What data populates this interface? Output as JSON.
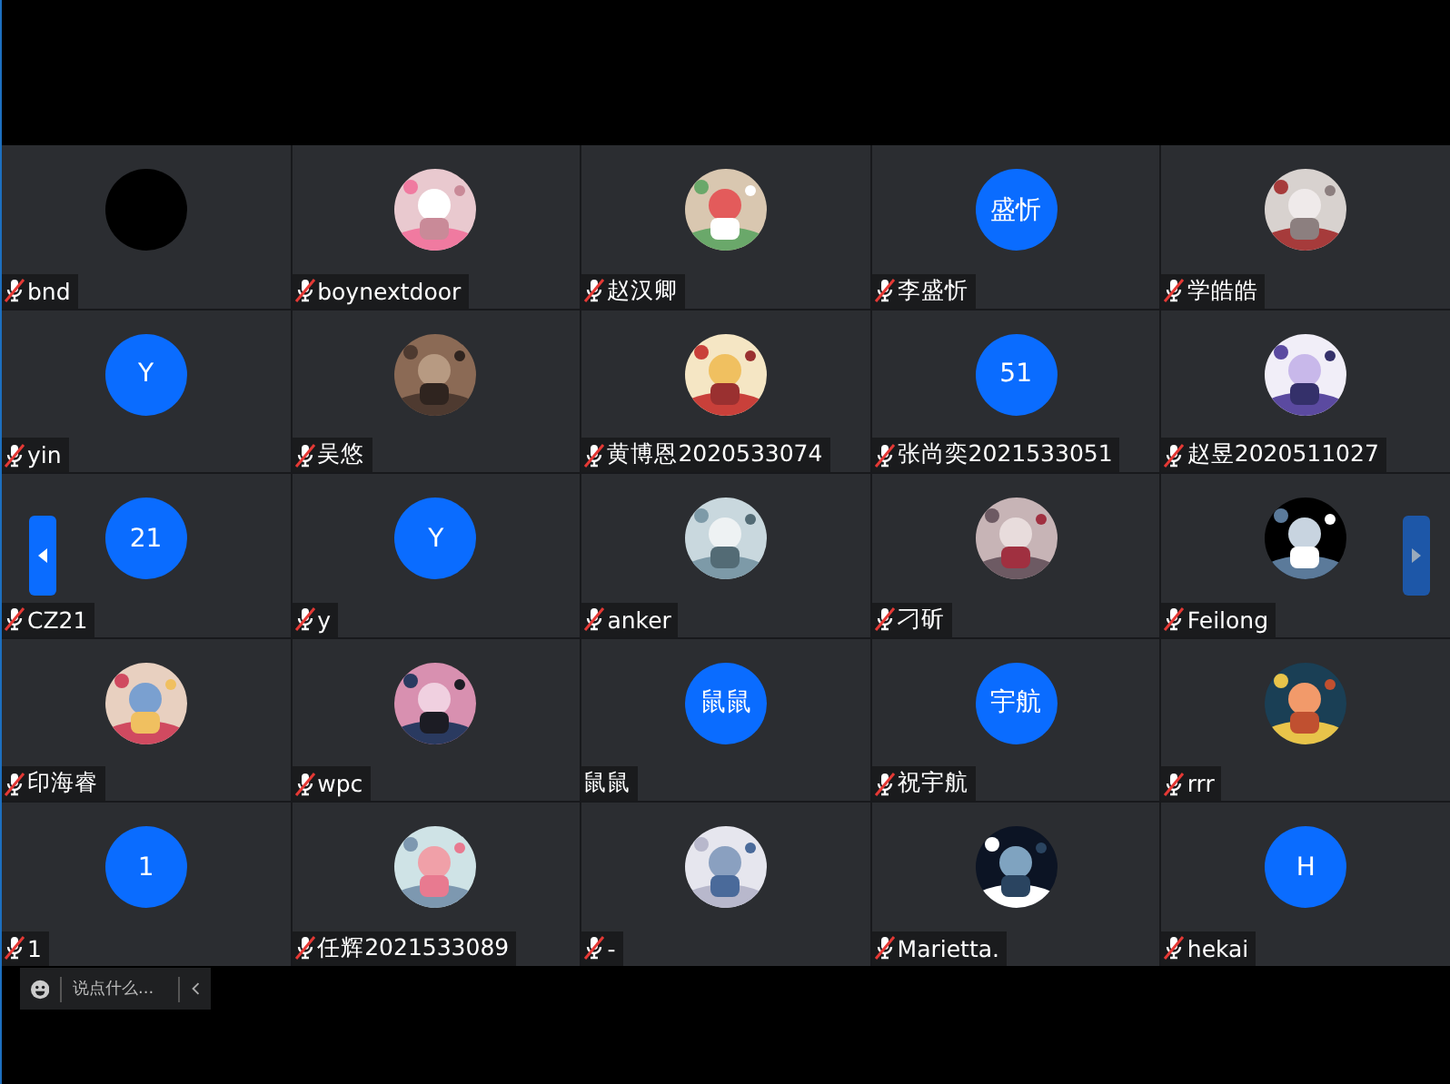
{
  "tiles": [
    {
      "name": "bnd",
      "muted": true,
      "avatar": {
        "kind": "blank"
      }
    },
    {
      "name": "boynextdoor",
      "muted": true
    },
    {
      "name": "赵汉卿",
      "muted": true
    },
    {
      "name": "李盛忻",
      "muted": true,
      "avatar": {
        "kind": "initials",
        "text": "盛忻"
      }
    },
    {
      "name": "学皓皓",
      "muted": true
    },
    {
      "name": "yin",
      "muted": true,
      "avatar": {
        "kind": "initials",
        "text": "Y"
      }
    },
    {
      "name": "吴悠",
      "muted": true
    },
    {
      "name": "黄博恩2020533074",
      "muted": true
    },
    {
      "name": "张尚奕2021533051",
      "muted": true,
      "avatar": {
        "kind": "initials",
        "text": "51"
      }
    },
    {
      "name": "赵昱2020511027",
      "muted": true
    },
    {
      "name": "CZ21",
      "muted": true,
      "avatar": {
        "kind": "initials",
        "text": "21"
      }
    },
    {
      "name": "y",
      "muted": true,
      "avatar": {
        "kind": "initials",
        "text": "Y"
      }
    },
    {
      "name": "anker",
      "muted": true
    },
    {
      "name": "刁斫",
      "muted": true
    },
    {
      "name": "Feilong",
      "muted": true
    },
    {
      "name": "印海睿",
      "muted": true
    },
    {
      "name": "wpc",
      "muted": true
    },
    {
      "name": "鼠鼠",
      "muted": false,
      "avatar": {
        "kind": "initials",
        "text": "鼠鼠"
      }
    },
    {
      "name": "祝宇航",
      "muted": true,
      "avatar": {
        "kind": "initials",
        "text": "宇航"
      }
    },
    {
      "name": "rrr",
      "muted": true
    },
    {
      "name": "1",
      "muted": true,
      "avatar": {
        "kind": "initials",
        "text": "1"
      }
    },
    {
      "name": "任辉2021533089",
      "muted": true
    },
    {
      "name": "-",
      "muted": true
    },
    {
      "name": "Marietta.",
      "muted": true
    },
    {
      "name": "hekai",
      "muted": true,
      "avatar": {
        "kind": "initials",
        "text": "H"
      }
    }
  ],
  "chat_input": {
    "placeholder": "说点什么..."
  }
}
